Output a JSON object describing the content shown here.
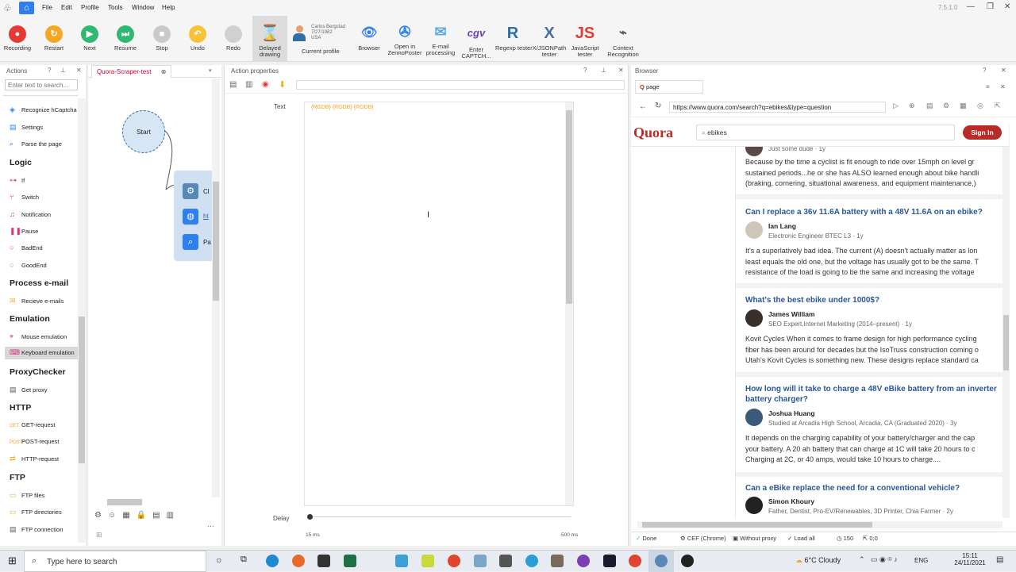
{
  "menu": {
    "items": [
      "File",
      "Edit",
      "Profile",
      "Tools",
      "Window",
      "Help"
    ],
    "version": "7.5.1.0"
  },
  "toolbar": {
    "recording": "Recording",
    "restart": "Restart",
    "next": "Next",
    "resume": "Resume",
    "stop": "Stop",
    "undo": "Undo",
    "redo": "Redo",
    "delayed": [
      "Delayed",
      "drawing"
    ],
    "profile": {
      "name": "Carlos Bergstad",
      "date": "7/27/1982",
      "country": "USA",
      "label": "Current profile"
    },
    "browser": "Browser",
    "zenno": [
      "Open in",
      "ZennoPoster"
    ],
    "email": [
      "E-mail",
      "processing"
    ],
    "captcha": [
      "Enter",
      "CAPTCH..."
    ],
    "regexp": "Regexp tester",
    "xjson": [
      "X/JSONPath",
      "tester"
    ],
    "js": [
      "JavaScript",
      "tester"
    ],
    "context": [
      "Context",
      "Recognition"
    ]
  },
  "actions": {
    "title": "Actions",
    "search_placeholder": "Enter text to search...",
    "items_top": [
      "Recognize hCaptcha",
      "Settings",
      "Parse the page"
    ],
    "logic": {
      "title": "Logic",
      "items": [
        "If",
        "Switch",
        "Notification",
        "Pause",
        "BadEnd",
        "GoodEnd"
      ]
    },
    "email": {
      "title": "Process e-mail",
      "items": [
        "Recieve e-mails"
      ]
    },
    "emulation": {
      "title": "Emulation",
      "items": [
        "Mouse emulation",
        "Keyboard emulation"
      ]
    },
    "proxy": {
      "title": "ProxyChecker",
      "items": [
        "Get proxy"
      ]
    },
    "http": {
      "title": "HTTP",
      "items": [
        "GET-request",
        "POST-request",
        "HTTP-request"
      ]
    },
    "ftp": {
      "title": "FTP",
      "items": [
        "FTP files",
        "FTP directories",
        "FTP connection"
      ]
    }
  },
  "canvas": {
    "tab": "Quora-Scraper-test",
    "start": "Start",
    "block_labels": [
      "Cl",
      "ht",
      "Pa"
    ]
  },
  "props": {
    "title": "Action properties",
    "text_label": "Text",
    "text_value": "{RGDB} {RGDB} {RGDB}",
    "delay_label": "Delay",
    "delay_min": "15 ms",
    "delay_max": "500 ms"
  },
  "browser": {
    "title": "Browser",
    "tab": "page",
    "url": "https://www.quora.com/search?q=ebikes&type=question",
    "logo": "Quora",
    "search": "ebikes",
    "signin": "Sign In",
    "first": {
      "cred": "Just some dude · 1y",
      "lines": [
        "Because by the time a cyclist is fit enough to ride over 15mph on level gr",
        "sustained periods...he or she has ALSO learned enough about bike handli",
        "(braking, cornering, situational awareness, and equipment maintenance,)"
      ]
    },
    "questions": [
      {
        "q": "Can I replace a 36v 11.6A battery with a 48V 11.6A on an ebike?",
        "author": "Ian Lang",
        "cred": "Electronic Engineer BTEC L3 · 1y",
        "lines": [
          "It's a superlatively bad idea. The current (A) doesn't actually matter as lon",
          "least equals the old one, but the voltage has usually got to be the same. T",
          "resistance of the load is going to be the same and increasing the voltage"
        ]
      },
      {
        "q": "What's the best ebike under 1000$?",
        "author": "James William",
        "cred": "SEO Expert,Internet Marketing (2014–present) · 1y",
        "lines": [
          "Kovit Cycles When it comes to frame design for high performance cycling",
          "fiber has been around for decades but the IsoTruss construction coming o",
          "Utah's Kovit Cycles is something new. These designs replace standard ca"
        ]
      },
      {
        "q": "How long will it take to charge a 48V eBike battery from an inverter",
        "q2": "battery charger?",
        "author": "Joshua Huang",
        "cred": "Studied at Arcadia High School, Arcadia, CA (Graduated 2020) · 3y",
        "lines": [
          "It depends on the charging capability of your battery/charger and the cap",
          "your battery. A 20 ah battery that can charge at 1C will take 20 hours to c",
          "Charging at 2C, or 40 amps, would take 10 hours to charge...."
        ]
      },
      {
        "q": "Can a eBike replace the need for a conventional vehicle?",
        "author": "Simon Khoury",
        "cred": "Father, Dentist, Pro-EV/Renewables, 3D Printer, Chia Farmer · 2y",
        "lines": []
      }
    ],
    "status": {
      "done": "Done",
      "engine": "CEF (Chrome)",
      "proxy": "Without proxy",
      "load": "Load all",
      "count": "150",
      "zero": "0;0"
    }
  },
  "taskbar": {
    "search": "Type here to search",
    "weather": "6°C  Cloudy",
    "lang": "ENG",
    "time": "15:11",
    "date": "24/11/2021"
  }
}
